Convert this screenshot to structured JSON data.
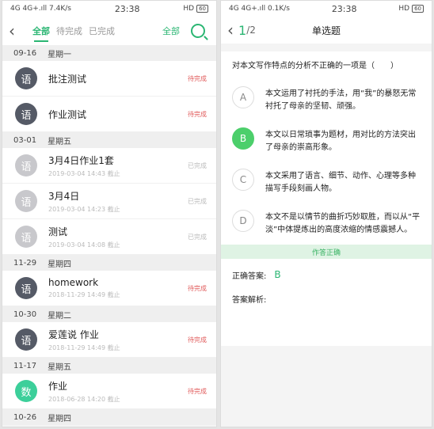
{
  "left": {
    "status": {
      "network": "4G 4G+.ıll 7.4K/s",
      "time": "23:38",
      "icons": "HD",
      "battery": "60"
    },
    "tabs": [
      {
        "label": "全部"
      },
      {
        "label": "待完成"
      },
      {
        "label": "已完成"
      }
    ],
    "filter_label": "全部",
    "groups": [
      {
        "date": "09-16",
        "weekday": "星期一",
        "items": [
          {
            "avatar": "语",
            "color": "#555a66",
            "title": "批注测试",
            "meta": "",
            "status": "待完成",
            "status_color": "#e05a5a"
          },
          {
            "avatar": "语",
            "color": "#555a66",
            "title": "作业测试",
            "meta": "",
            "status": "待完成",
            "status_color": "#e05a5a"
          }
        ]
      },
      {
        "date": "03-01",
        "weekday": "星期五",
        "items": [
          {
            "avatar": "语",
            "color": "#c8c8cc",
            "title": "3月4日作业1套",
            "meta": "2019-03-04 14:43 截止",
            "status": "已完成",
            "status_color": "#bbbbbb"
          },
          {
            "avatar": "语",
            "color": "#c8c8cc",
            "title": "3月4日",
            "meta": "2019-03-04 14:23 截止",
            "status": "已完成",
            "status_color": "#bbbbbb"
          },
          {
            "avatar": "语",
            "color": "#c8c8cc",
            "title": "测试",
            "meta": "2019-03-04 14:08 截止",
            "status": "已完成",
            "status_color": "#bbbbbb"
          }
        ]
      },
      {
        "date": "11-29",
        "weekday": "星期四",
        "items": [
          {
            "avatar": "语",
            "color": "#555a66",
            "title": "homework",
            "meta": "2018-11-29 14:49 截止",
            "status": "待完成",
            "status_color": "#e05a5a"
          }
        ]
      },
      {
        "date": "10-30",
        "weekday": "星期二",
        "items": [
          {
            "avatar": "语",
            "color": "#555a66",
            "title": "爱莲说 作业",
            "meta": "2018-11-29 14:49 截止",
            "status": "待完成",
            "status_color": "#e05a5a"
          }
        ]
      },
      {
        "date": "11-17",
        "weekday": "星期五",
        "items": [
          {
            "avatar": "数",
            "color": "#3ccf9a",
            "title": "作业",
            "meta": "2018-06-28 14:20 截止",
            "status": "待完成",
            "status_color": "#e05a5a"
          }
        ]
      },
      {
        "date": "10-26",
        "weekday": "星期四",
        "items": []
      }
    ]
  },
  "right": {
    "status": {
      "network": "4G 4G+.ıll 0.1K/s",
      "time": "23:38",
      "icons": "HD",
      "battery": "60"
    },
    "question_number": "1",
    "question_total": "/2",
    "question_type": "单选题",
    "question_text": "对本文写作特点的分析不正确的一项是（　　）",
    "options": [
      {
        "letter": "A",
        "text": "本文运用了衬托的手法，用“我”的暴怒无常衬托了母亲的坚韧、顽强。",
        "selected": false
      },
      {
        "letter": "B",
        "text": "本文以日常琐事为题材，用对比的方法突出了母亲的崇高形象。",
        "selected": true
      },
      {
        "letter": "C",
        "text": "本文采用了语言、细节、动作、心理等多种描写手段刻画人物。",
        "selected": false
      },
      {
        "letter": "D",
        "text": "本文不是以情节的曲折巧妙取胜，而以从“平淡”中体提炼出的高度浓缩的情感震撼人。",
        "selected": false
      }
    ],
    "result": "作答正确",
    "answer_label": "正确答案:",
    "answer_value": "B",
    "analysis_label": "答案解析:"
  }
}
